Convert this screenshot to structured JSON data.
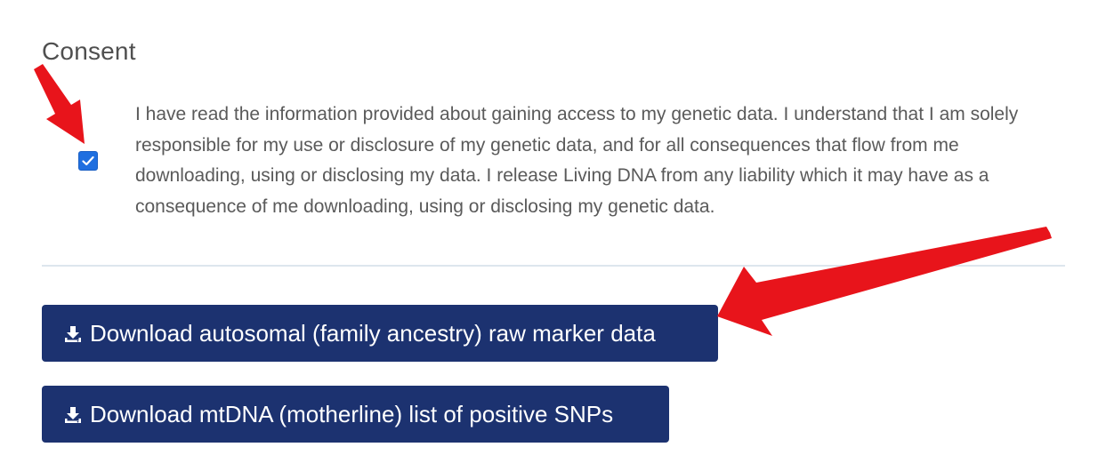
{
  "consent": {
    "title": "Consent",
    "checked": true,
    "text": "I have read the information provided about gaining access to my genetic data. I understand that I am solely responsible for my use or disclosure of my genetic data, and for all consequences that flow from me downloading, using or disclosing my data. I release Living DNA from any liability which it may have as a consequence of me downloading, using or disclosing my genetic data."
  },
  "downloads": [
    {
      "label": "Download autosomal (family ancestry) raw marker data",
      "icon": "download-icon"
    },
    {
      "label": "Download mtDNA (motherline) list of positive SNPs",
      "icon": "download-icon"
    }
  ],
  "colors": {
    "button_bg": "#1c3270",
    "checkbox_bg": "#1f6fe0",
    "annotation_arrow": "#e8141b",
    "divider": "#dde6ee"
  }
}
